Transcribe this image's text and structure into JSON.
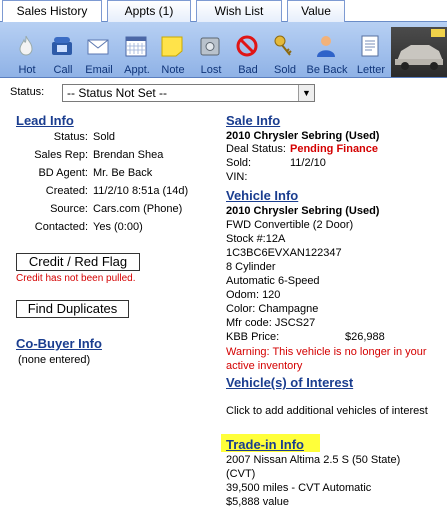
{
  "tabs": [
    {
      "label": "Sales History"
    },
    {
      "label": "Appts (1)"
    },
    {
      "label": "Wish List"
    },
    {
      "label": "Value"
    }
  ],
  "toolbar": [
    {
      "label": "Hot",
      "icon": "flame-icon"
    },
    {
      "label": "Call",
      "icon": "phone-icon"
    },
    {
      "label": "Email",
      "icon": "envelope-icon"
    },
    {
      "label": "Appt.",
      "icon": "calendar-icon"
    },
    {
      "label": "Note",
      "icon": "sticky-note-icon"
    },
    {
      "label": "Lost",
      "icon": "safe-icon"
    },
    {
      "label": "Bad",
      "icon": "prohibited-icon"
    },
    {
      "label": "Sold",
      "icon": "keys-icon"
    },
    {
      "label": "Be Back",
      "icon": "person-icon"
    },
    {
      "label": "Letter",
      "icon": "letter-icon"
    }
  ],
  "status": {
    "label": "Status:",
    "value": "-- Status Not Set --"
  },
  "lead": {
    "title": "Lead Info",
    "rows": [
      {
        "k": "Status:",
        "v": "Sold"
      },
      {
        "k": "Sales Rep:",
        "v": "Brendan Shea"
      },
      {
        "k": "BD Agent:",
        "v": "Mr. Be Back"
      },
      {
        "k": "Created:",
        "v": "11/2/10 8:51a (14d)"
      },
      {
        "k": "Source:",
        "v": "Cars.com (Phone)"
      },
      {
        "k": "Contacted:",
        "v": "Yes (0:00)"
      }
    ]
  },
  "credit": {
    "button": "Credit / Red Flag",
    "note": "Credit has not been pulled."
  },
  "duplicates": {
    "button": "Find Duplicates"
  },
  "cobuyer": {
    "title": "Co-Buyer Info",
    "value": "(none entered)"
  },
  "sale": {
    "title": "Sale Info",
    "vehicle": "2010 Chrysler Sebring (Used)",
    "deal_label": "Deal Status:",
    "deal_value": "Pending Finance",
    "sold_label": "Sold:",
    "sold_value": "11/2/10",
    "vin_label": "VIN:"
  },
  "vehicle": {
    "title": "Vehicle Info",
    "name": "2010 Chrysler Sebring (Used)",
    "lines": [
      "FWD Convertible (2 Door)",
      "Stock #:12A",
      "1C3BC6EVXAN122347",
      "8 Cylinder",
      "Automatic 6-Speed",
      "Odom: 120",
      "Color: Champagne",
      "Mfr code: JSCS27"
    ],
    "kbb_label": "KBB Price:",
    "kbb_value": "$26,988",
    "warning": "Warning: This vehicle is no longer in your active inventory"
  },
  "interest": {
    "title": "Vehicle(s) of Interest",
    "text": "Click to add additional vehicles of interest"
  },
  "tradein": {
    "title": "Trade-in Info",
    "line1": "2007 Nissan Altima 2.5 S (50 State)",
    "line2": "(CVT)",
    "line3": "39,500 miles - CVT Automatic",
    "line4": "$5,888 value"
  }
}
